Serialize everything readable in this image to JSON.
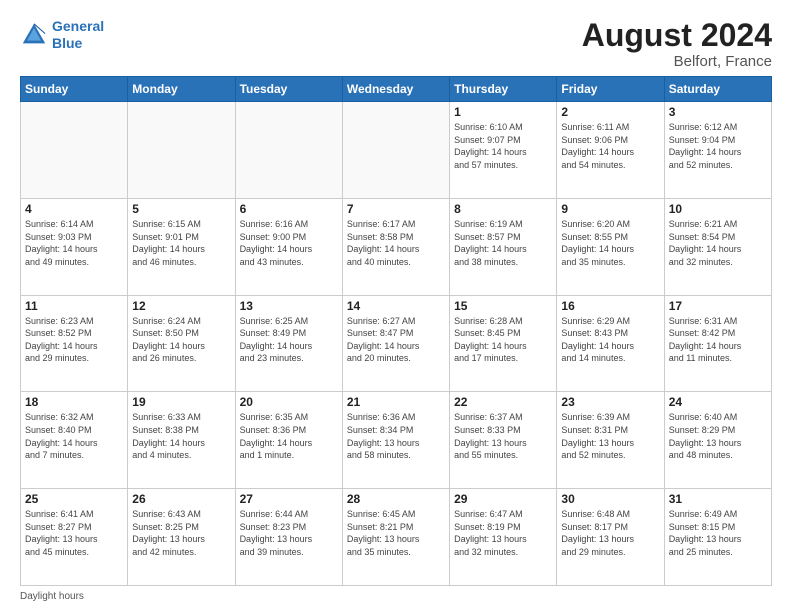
{
  "header": {
    "logo_line1": "General",
    "logo_line2": "Blue",
    "month_year": "August 2024",
    "location": "Belfort, France"
  },
  "days_of_week": [
    "Sunday",
    "Monday",
    "Tuesday",
    "Wednesday",
    "Thursday",
    "Friday",
    "Saturday"
  ],
  "footer_note": "Daylight hours",
  "weeks": [
    [
      {
        "day": "",
        "info": ""
      },
      {
        "day": "",
        "info": ""
      },
      {
        "day": "",
        "info": ""
      },
      {
        "day": "",
        "info": ""
      },
      {
        "day": "1",
        "info": "Sunrise: 6:10 AM\nSunset: 9:07 PM\nDaylight: 14 hours\nand 57 minutes."
      },
      {
        "day": "2",
        "info": "Sunrise: 6:11 AM\nSunset: 9:06 PM\nDaylight: 14 hours\nand 54 minutes."
      },
      {
        "day": "3",
        "info": "Sunrise: 6:12 AM\nSunset: 9:04 PM\nDaylight: 14 hours\nand 52 minutes."
      }
    ],
    [
      {
        "day": "4",
        "info": "Sunrise: 6:14 AM\nSunset: 9:03 PM\nDaylight: 14 hours\nand 49 minutes."
      },
      {
        "day": "5",
        "info": "Sunrise: 6:15 AM\nSunset: 9:01 PM\nDaylight: 14 hours\nand 46 minutes."
      },
      {
        "day": "6",
        "info": "Sunrise: 6:16 AM\nSunset: 9:00 PM\nDaylight: 14 hours\nand 43 minutes."
      },
      {
        "day": "7",
        "info": "Sunrise: 6:17 AM\nSunset: 8:58 PM\nDaylight: 14 hours\nand 40 minutes."
      },
      {
        "day": "8",
        "info": "Sunrise: 6:19 AM\nSunset: 8:57 PM\nDaylight: 14 hours\nand 38 minutes."
      },
      {
        "day": "9",
        "info": "Sunrise: 6:20 AM\nSunset: 8:55 PM\nDaylight: 14 hours\nand 35 minutes."
      },
      {
        "day": "10",
        "info": "Sunrise: 6:21 AM\nSunset: 8:54 PM\nDaylight: 14 hours\nand 32 minutes."
      }
    ],
    [
      {
        "day": "11",
        "info": "Sunrise: 6:23 AM\nSunset: 8:52 PM\nDaylight: 14 hours\nand 29 minutes."
      },
      {
        "day": "12",
        "info": "Sunrise: 6:24 AM\nSunset: 8:50 PM\nDaylight: 14 hours\nand 26 minutes."
      },
      {
        "day": "13",
        "info": "Sunrise: 6:25 AM\nSunset: 8:49 PM\nDaylight: 14 hours\nand 23 minutes."
      },
      {
        "day": "14",
        "info": "Sunrise: 6:27 AM\nSunset: 8:47 PM\nDaylight: 14 hours\nand 20 minutes."
      },
      {
        "day": "15",
        "info": "Sunrise: 6:28 AM\nSunset: 8:45 PM\nDaylight: 14 hours\nand 17 minutes."
      },
      {
        "day": "16",
        "info": "Sunrise: 6:29 AM\nSunset: 8:43 PM\nDaylight: 14 hours\nand 14 minutes."
      },
      {
        "day": "17",
        "info": "Sunrise: 6:31 AM\nSunset: 8:42 PM\nDaylight: 14 hours\nand 11 minutes."
      }
    ],
    [
      {
        "day": "18",
        "info": "Sunrise: 6:32 AM\nSunset: 8:40 PM\nDaylight: 14 hours\nand 7 minutes."
      },
      {
        "day": "19",
        "info": "Sunrise: 6:33 AM\nSunset: 8:38 PM\nDaylight: 14 hours\nand 4 minutes."
      },
      {
        "day": "20",
        "info": "Sunrise: 6:35 AM\nSunset: 8:36 PM\nDaylight: 14 hours\nand 1 minute."
      },
      {
        "day": "21",
        "info": "Sunrise: 6:36 AM\nSunset: 8:34 PM\nDaylight: 13 hours\nand 58 minutes."
      },
      {
        "day": "22",
        "info": "Sunrise: 6:37 AM\nSunset: 8:33 PM\nDaylight: 13 hours\nand 55 minutes."
      },
      {
        "day": "23",
        "info": "Sunrise: 6:39 AM\nSunset: 8:31 PM\nDaylight: 13 hours\nand 52 minutes."
      },
      {
        "day": "24",
        "info": "Sunrise: 6:40 AM\nSunset: 8:29 PM\nDaylight: 13 hours\nand 48 minutes."
      }
    ],
    [
      {
        "day": "25",
        "info": "Sunrise: 6:41 AM\nSunset: 8:27 PM\nDaylight: 13 hours\nand 45 minutes."
      },
      {
        "day": "26",
        "info": "Sunrise: 6:43 AM\nSunset: 8:25 PM\nDaylight: 13 hours\nand 42 minutes."
      },
      {
        "day": "27",
        "info": "Sunrise: 6:44 AM\nSunset: 8:23 PM\nDaylight: 13 hours\nand 39 minutes."
      },
      {
        "day": "28",
        "info": "Sunrise: 6:45 AM\nSunset: 8:21 PM\nDaylight: 13 hours\nand 35 minutes."
      },
      {
        "day": "29",
        "info": "Sunrise: 6:47 AM\nSunset: 8:19 PM\nDaylight: 13 hours\nand 32 minutes."
      },
      {
        "day": "30",
        "info": "Sunrise: 6:48 AM\nSunset: 8:17 PM\nDaylight: 13 hours\nand 29 minutes."
      },
      {
        "day": "31",
        "info": "Sunrise: 6:49 AM\nSunset: 8:15 PM\nDaylight: 13 hours\nand 25 minutes."
      }
    ]
  ]
}
